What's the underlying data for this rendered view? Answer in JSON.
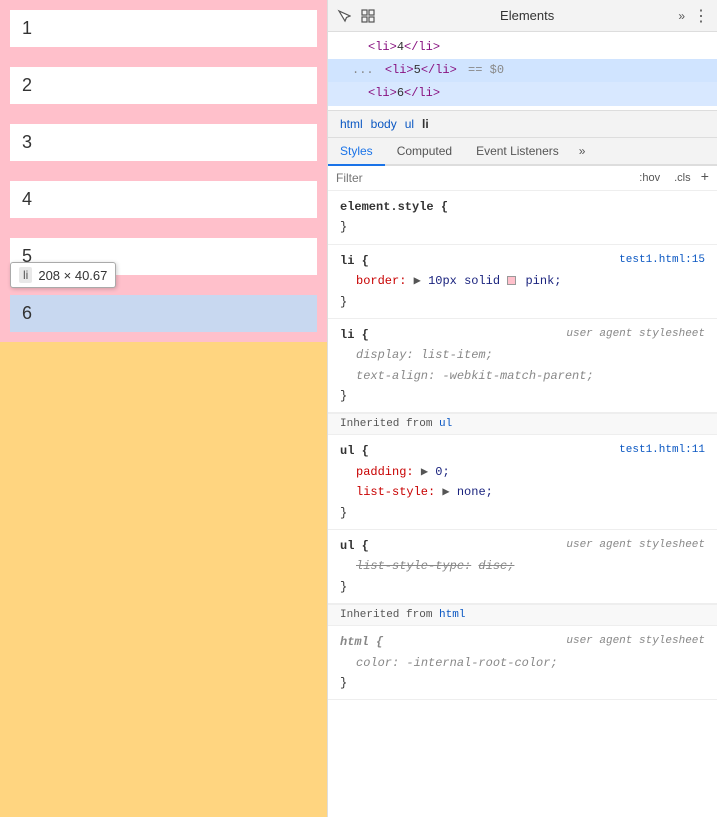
{
  "left": {
    "items": [
      {
        "id": 1,
        "label": "1"
      },
      {
        "id": 2,
        "label": "2"
      },
      {
        "id": 3,
        "label": "3"
      },
      {
        "id": 4,
        "label": "4"
      },
      {
        "id": 5,
        "label": "5",
        "selected": true
      },
      {
        "id": 6,
        "label": "6",
        "highlighted": true
      }
    ],
    "tooltip": {
      "tag": "li",
      "size": "208 × 40.67"
    }
  },
  "devtools": {
    "title": "Elements",
    "tabs": [
      "Styles",
      "Computed",
      "Event Listeners"
    ],
    "active_tab": "Styles",
    "breadcrumb": [
      "html",
      "body",
      "ul",
      "li"
    ],
    "tree": [
      {
        "indent": 2,
        "html": "<li>4</li>"
      },
      {
        "indent": 2,
        "html": "<li>5</li>",
        "marker": "== $0",
        "selected": true
      },
      {
        "indent": 2,
        "html": "<li>6</li>",
        "cursor": true
      }
    ],
    "filter_placeholder": "Filter",
    "filter_hov": ":hov",
    "filter_cls": ".cls",
    "rules": [
      {
        "selector": "element.style {",
        "source": "",
        "properties": [],
        "close": "}"
      },
      {
        "selector": "li {",
        "source": "test1.html:15",
        "properties": [
          {
            "name": "border:",
            "arrow": true,
            "value": "10px solid",
            "color": "pink",
            "color_hex": "pink",
            "unit": ";"
          }
        ],
        "close": "}"
      },
      {
        "selector": "li {",
        "source": "user agent stylesheet",
        "source_italic": true,
        "properties": [
          {
            "name": "display:",
            "value": "list-item",
            "unit": ";"
          },
          {
            "name": "text-align:",
            "value": "-webkit-match-parent",
            "unit": ";"
          }
        ],
        "close": "}"
      },
      {
        "type": "inherited_header",
        "label": "Inherited from",
        "tag": "ul"
      },
      {
        "selector": "ul {",
        "source": "test1.html:11",
        "properties": [
          {
            "name": "padding:",
            "arrow": true,
            "value": "0",
            "unit": ";"
          },
          {
            "name": "list-style:",
            "arrow": true,
            "value": "none",
            "unit": ";"
          }
        ],
        "close": "}"
      },
      {
        "selector": "ul {",
        "source": "user agent stylesheet",
        "source_italic": true,
        "properties": [
          {
            "name": "list-style-type:",
            "value": "disc",
            "unit": ";",
            "strikethrough": true
          }
        ],
        "close": "}"
      },
      {
        "type": "inherited_header",
        "label": "Inherited from",
        "tag": "html"
      },
      {
        "selector": "html {",
        "source": "user agent stylesheet",
        "source_italic": true,
        "properties": [
          {
            "name": "color:",
            "value": "-internal-root-color",
            "unit": ";"
          }
        ],
        "close": "}"
      }
    ]
  }
}
